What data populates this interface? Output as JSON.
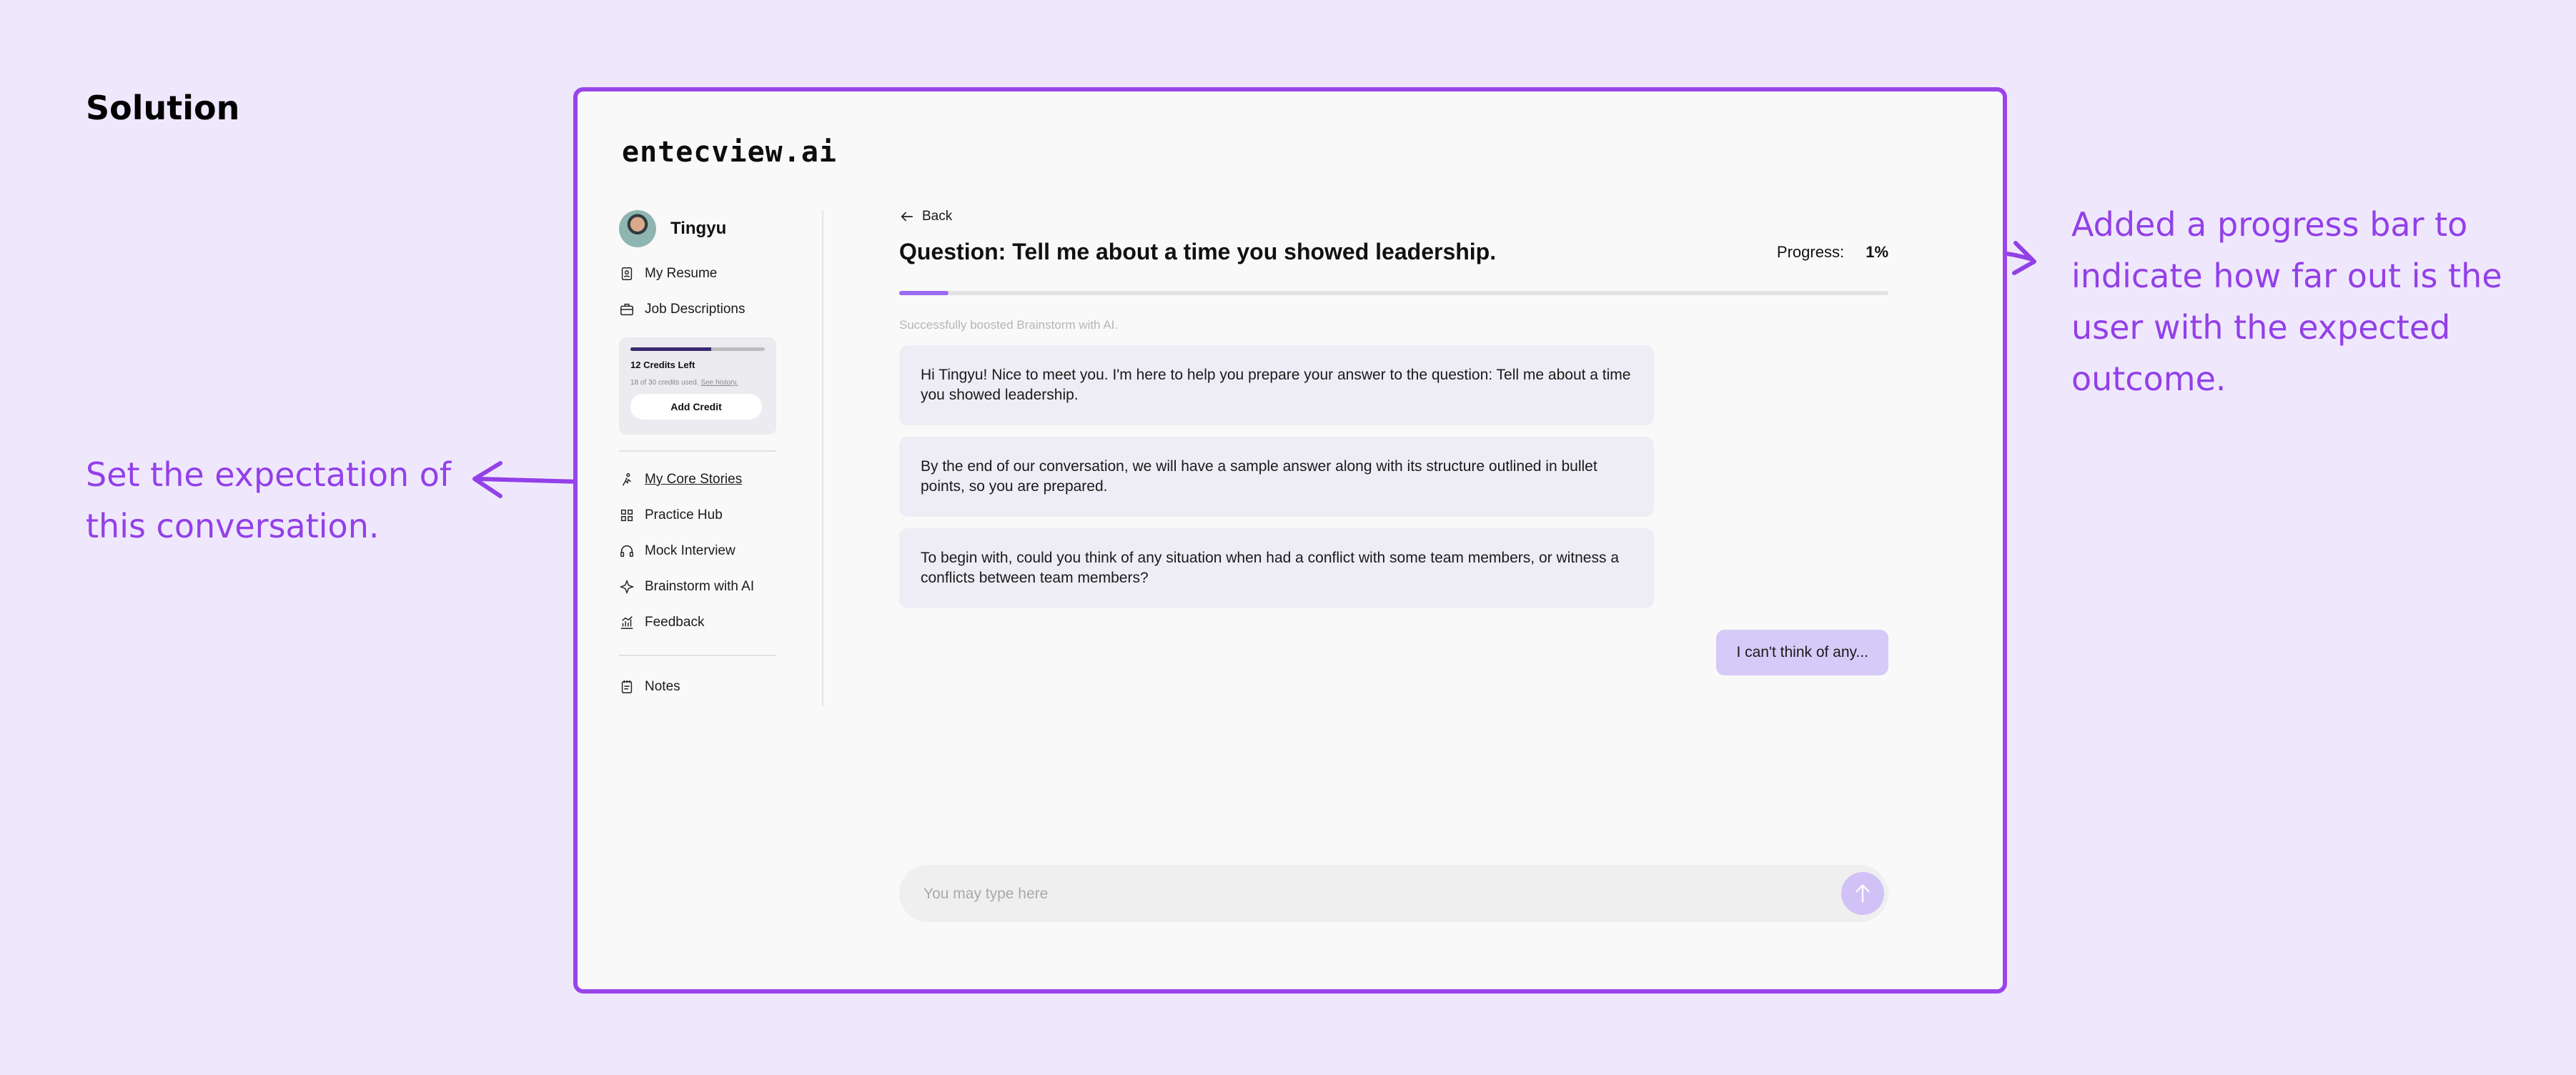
{
  "slide": {
    "title": "Solution",
    "annotation_left": "Set the expectation of this conversation.",
    "annotation_right": "Added a progress bar to indicate how far out is the user with the expected outcome."
  },
  "app": {
    "logo": "entecview.ai",
    "user": {
      "name": "Tingyu"
    },
    "nav_top": [
      {
        "label": "My Resume",
        "icon": "resume-icon"
      },
      {
        "label": "Job Descriptions",
        "icon": "briefcase-icon"
      }
    ],
    "credits": {
      "left_label": "12 Credits Left",
      "used_text": "18 of 30 credits used.",
      "history_link": "See history.",
      "add_button": "Add Credit",
      "used_fraction": 0.6
    },
    "nav_main": [
      {
        "label": "My Core Stories",
        "icon": "stories-icon"
      },
      {
        "label": "Practice Hub",
        "icon": "grid-icon"
      },
      {
        "label": "Mock Interview",
        "icon": "headset-icon"
      },
      {
        "label": "Brainstorm with AI",
        "icon": "sparkle-icon"
      },
      {
        "label": "Feedback",
        "icon": "chart-icon"
      }
    ],
    "nav_bottom": [
      {
        "label": "Notes",
        "icon": "notes-icon"
      }
    ]
  },
  "main": {
    "back_label": "Back",
    "question": "Question: Tell me about a time you showed leadership.",
    "progress_label": "Progress:",
    "progress_value": "1%",
    "progress_fraction": 0.05,
    "status": "Successfully boosted Brainstorm with AI.",
    "messages": [
      "Hi Tingyu! Nice to meet you. I'm here to help you prepare your answer to the question: Tell me about a time you showed leadership.",
      "By the end of our conversation, we will have a sample answer along with its structure outlined in bullet points, so you are prepared.",
      "To begin with, could you think of any situation when had a conflict with some team members, or witness a conflicts between team members?"
    ],
    "user_message": "I can't think of any...",
    "input_placeholder": "You may type here"
  },
  "colors": {
    "background": "#efe8fd",
    "accent": "#9a45ea",
    "annotation": "#9340e8",
    "user_bubble": "#d6caf8",
    "ai_bubble": "#eeedf5"
  }
}
